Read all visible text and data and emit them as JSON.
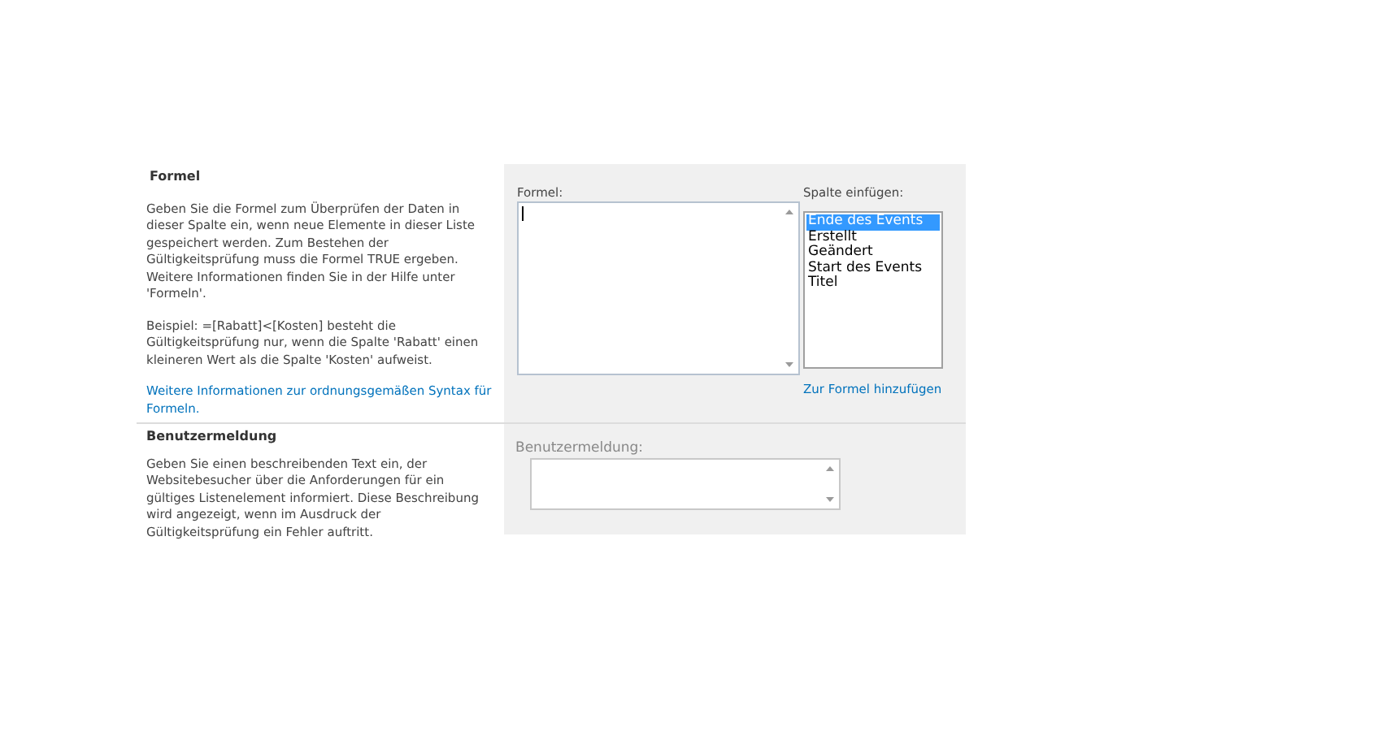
{
  "formula_section": {
    "title": "Formel",
    "description": "Geben Sie die Formel zum Überprüfen der Daten in dieser Spalte ein, wenn neue Elemente in dieser Liste gespeichert werden. Zum Bestehen der Gültigkeitsprüfung muss die Formel TRUE ergeben. Weitere Informationen finden Sie in der Hilfe unter 'Formeln'.",
    "example": "Beispiel: =[Rabatt]<[Kosten] besteht die Gültigkeitsprüfung nur, wenn die Spalte 'Rabatt' einen kleineren Wert als die Spalte 'Kosten' aufweist.",
    "link": "Weitere Informationen zur ordnungsgemäßen Syntax für Formeln.",
    "formula_label": "Formel:",
    "insert_label": "Spalte einfügen:",
    "columns": [
      {
        "label": "Ende des Events",
        "selected": true
      },
      {
        "label": "Erstellt",
        "selected": false
      },
      {
        "label": "Geändert",
        "selected": false
      },
      {
        "label": "Start des Events",
        "selected": false
      },
      {
        "label": "Titel",
        "selected": false
      }
    ],
    "add_link": "Zur Formel hinzufügen"
  },
  "message_section": {
    "title": "Benutzermeldung",
    "description": "Geben Sie einen beschreibenden Text ein, der Websitebesucher über die Anforderungen für ein gültiges Listenelement informiert. Diese Beschreibung wird angezeigt, wenn im Ausdruck der Gültigkeitsprüfung ein Fehler auftritt.",
    "field_label": "Benutzermeldung:"
  }
}
